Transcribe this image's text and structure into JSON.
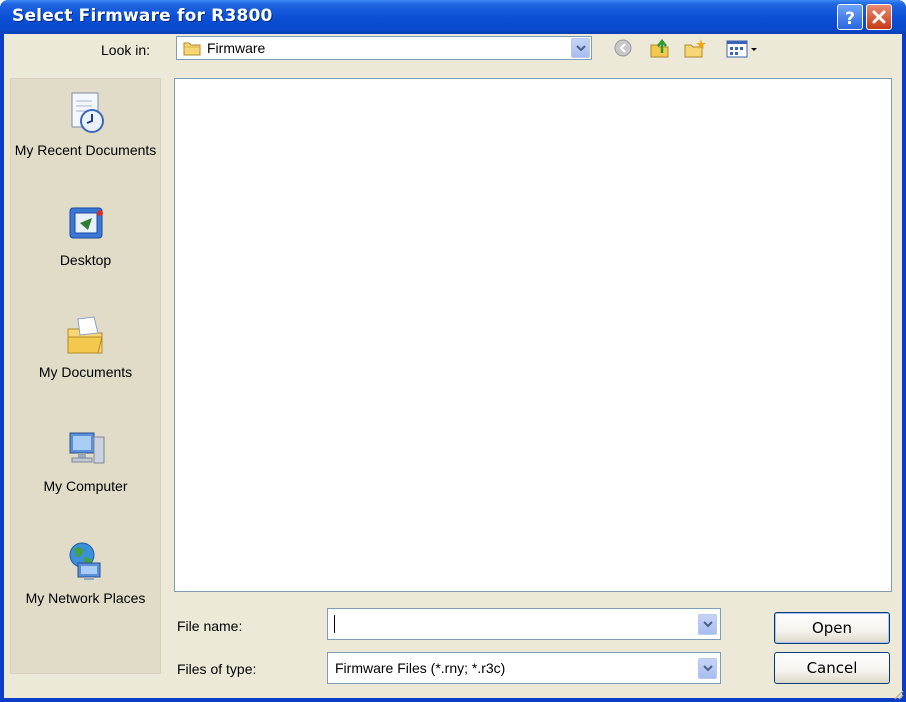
{
  "window": {
    "title": "Select Firmware for R3800",
    "controls": {
      "help_icon": "help-icon",
      "close_icon": "close-icon"
    }
  },
  "toolbar": {
    "look_in_label": "Look in:",
    "look_in_value": "Firmware",
    "icons": [
      "back-icon",
      "up-folder-icon",
      "new-folder-icon",
      "views-menu-icon"
    ]
  },
  "places": [
    {
      "label": "My Recent Documents",
      "icon": "recent-documents-icon"
    },
    {
      "label": "Desktop",
      "icon": "desktop-icon"
    },
    {
      "label": "My Documents",
      "icon": "my-documents-icon"
    },
    {
      "label": "My Computer",
      "icon": "my-computer-icon"
    },
    {
      "label": "My Network Places",
      "icon": "network-places-icon"
    }
  ],
  "file_name": {
    "label": "File name:",
    "value": ""
  },
  "file_type": {
    "label": "Files of type:",
    "value": "Firmware Files (*.rny; *.r3c)"
  },
  "buttons": {
    "open": "Open",
    "cancel": "Cancel"
  },
  "colors": {
    "titlebar": "#0a48cc",
    "dialog_bg": "#ece9d8",
    "close_button": "#c83a16"
  }
}
